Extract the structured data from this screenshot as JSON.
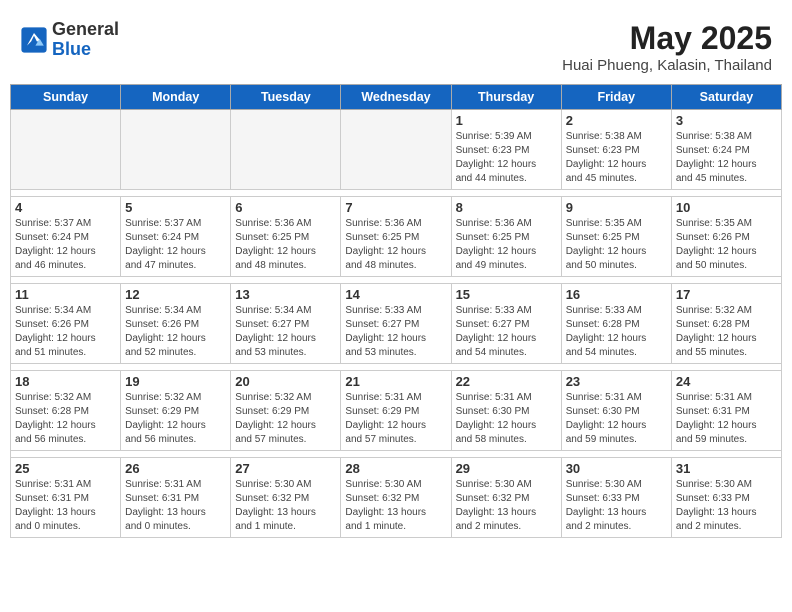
{
  "header": {
    "logo_general": "General",
    "logo_blue": "Blue",
    "month_title": "May 2025",
    "location": "Huai Phueng, Kalasin, Thailand"
  },
  "days_of_week": [
    "Sunday",
    "Monday",
    "Tuesday",
    "Wednesday",
    "Thursday",
    "Friday",
    "Saturday"
  ],
  "weeks": [
    [
      {
        "day": "",
        "info": ""
      },
      {
        "day": "",
        "info": ""
      },
      {
        "day": "",
        "info": ""
      },
      {
        "day": "",
        "info": ""
      },
      {
        "day": "1",
        "info": "Sunrise: 5:39 AM\nSunset: 6:23 PM\nDaylight: 12 hours\nand 44 minutes."
      },
      {
        "day": "2",
        "info": "Sunrise: 5:38 AM\nSunset: 6:23 PM\nDaylight: 12 hours\nand 45 minutes."
      },
      {
        "day": "3",
        "info": "Sunrise: 5:38 AM\nSunset: 6:24 PM\nDaylight: 12 hours\nand 45 minutes."
      }
    ],
    [
      {
        "day": "4",
        "info": "Sunrise: 5:37 AM\nSunset: 6:24 PM\nDaylight: 12 hours\nand 46 minutes."
      },
      {
        "day": "5",
        "info": "Sunrise: 5:37 AM\nSunset: 6:24 PM\nDaylight: 12 hours\nand 47 minutes."
      },
      {
        "day": "6",
        "info": "Sunrise: 5:36 AM\nSunset: 6:25 PM\nDaylight: 12 hours\nand 48 minutes."
      },
      {
        "day": "7",
        "info": "Sunrise: 5:36 AM\nSunset: 6:25 PM\nDaylight: 12 hours\nand 48 minutes."
      },
      {
        "day": "8",
        "info": "Sunrise: 5:36 AM\nSunset: 6:25 PM\nDaylight: 12 hours\nand 49 minutes."
      },
      {
        "day": "9",
        "info": "Sunrise: 5:35 AM\nSunset: 6:25 PM\nDaylight: 12 hours\nand 50 minutes."
      },
      {
        "day": "10",
        "info": "Sunrise: 5:35 AM\nSunset: 6:26 PM\nDaylight: 12 hours\nand 50 minutes."
      }
    ],
    [
      {
        "day": "11",
        "info": "Sunrise: 5:34 AM\nSunset: 6:26 PM\nDaylight: 12 hours\nand 51 minutes."
      },
      {
        "day": "12",
        "info": "Sunrise: 5:34 AM\nSunset: 6:26 PM\nDaylight: 12 hours\nand 52 minutes."
      },
      {
        "day": "13",
        "info": "Sunrise: 5:34 AM\nSunset: 6:27 PM\nDaylight: 12 hours\nand 53 minutes."
      },
      {
        "day": "14",
        "info": "Sunrise: 5:33 AM\nSunset: 6:27 PM\nDaylight: 12 hours\nand 53 minutes."
      },
      {
        "day": "15",
        "info": "Sunrise: 5:33 AM\nSunset: 6:27 PM\nDaylight: 12 hours\nand 54 minutes."
      },
      {
        "day": "16",
        "info": "Sunrise: 5:33 AM\nSunset: 6:28 PM\nDaylight: 12 hours\nand 54 minutes."
      },
      {
        "day": "17",
        "info": "Sunrise: 5:32 AM\nSunset: 6:28 PM\nDaylight: 12 hours\nand 55 minutes."
      }
    ],
    [
      {
        "day": "18",
        "info": "Sunrise: 5:32 AM\nSunset: 6:28 PM\nDaylight: 12 hours\nand 56 minutes."
      },
      {
        "day": "19",
        "info": "Sunrise: 5:32 AM\nSunset: 6:29 PM\nDaylight: 12 hours\nand 56 minutes."
      },
      {
        "day": "20",
        "info": "Sunrise: 5:32 AM\nSunset: 6:29 PM\nDaylight: 12 hours\nand 57 minutes."
      },
      {
        "day": "21",
        "info": "Sunrise: 5:31 AM\nSunset: 6:29 PM\nDaylight: 12 hours\nand 57 minutes."
      },
      {
        "day": "22",
        "info": "Sunrise: 5:31 AM\nSunset: 6:30 PM\nDaylight: 12 hours\nand 58 minutes."
      },
      {
        "day": "23",
        "info": "Sunrise: 5:31 AM\nSunset: 6:30 PM\nDaylight: 12 hours\nand 59 minutes."
      },
      {
        "day": "24",
        "info": "Sunrise: 5:31 AM\nSunset: 6:31 PM\nDaylight: 12 hours\nand 59 minutes."
      }
    ],
    [
      {
        "day": "25",
        "info": "Sunrise: 5:31 AM\nSunset: 6:31 PM\nDaylight: 13 hours\nand 0 minutes."
      },
      {
        "day": "26",
        "info": "Sunrise: 5:31 AM\nSunset: 6:31 PM\nDaylight: 13 hours\nand 0 minutes."
      },
      {
        "day": "27",
        "info": "Sunrise: 5:30 AM\nSunset: 6:32 PM\nDaylight: 13 hours\nand 1 minute."
      },
      {
        "day": "28",
        "info": "Sunrise: 5:30 AM\nSunset: 6:32 PM\nDaylight: 13 hours\nand 1 minute."
      },
      {
        "day": "29",
        "info": "Sunrise: 5:30 AM\nSunset: 6:32 PM\nDaylight: 13 hours\nand 2 minutes."
      },
      {
        "day": "30",
        "info": "Sunrise: 5:30 AM\nSunset: 6:33 PM\nDaylight: 13 hours\nand 2 minutes."
      },
      {
        "day": "31",
        "info": "Sunrise: 5:30 AM\nSunset: 6:33 PM\nDaylight: 13 hours\nand 2 minutes."
      }
    ]
  ]
}
